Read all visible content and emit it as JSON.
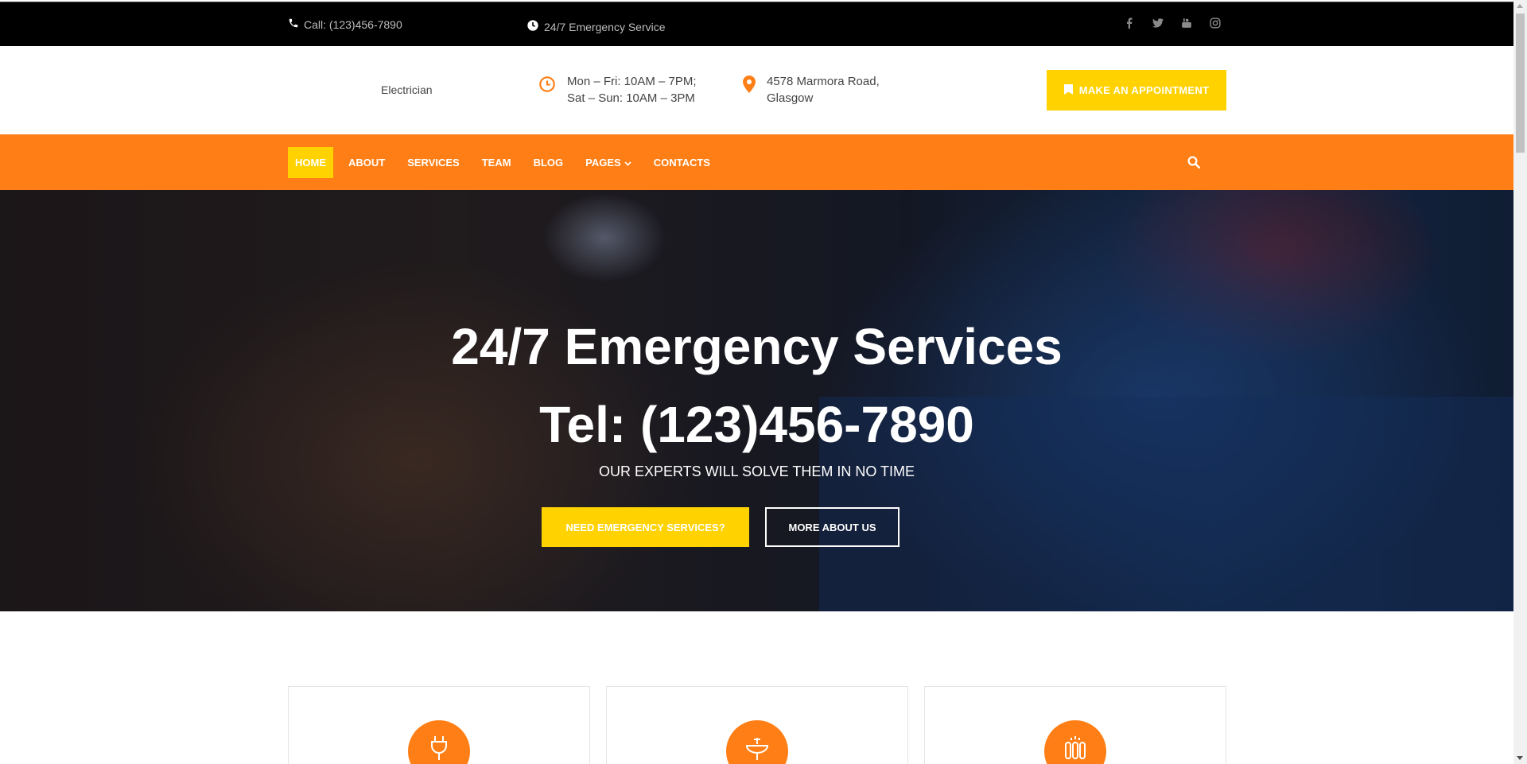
{
  "topbar": {
    "call": "Call: (123)456-7890",
    "emergency": "24/7 Emergency Service",
    "social": [
      "facebook-icon",
      "twitter-icon",
      "youtube-icon",
      "instagram-icon"
    ]
  },
  "header": {
    "brand": "Electrician",
    "hours_line1": "Mon – Fri: 10AM – 7PM;",
    "hours_line2": "Sat – Sun: 10AM – 3PM",
    "address_line1": "4578 Marmora Road,",
    "address_line2": "Glasgow",
    "appointment_label": "MAKE AN APPOINTMENT"
  },
  "nav": {
    "items": [
      {
        "label": "HOME"
      },
      {
        "label": "ABOUT"
      },
      {
        "label": "SERVICES"
      },
      {
        "label": "TEAM"
      },
      {
        "label": "BLOG"
      },
      {
        "label": "PAGES"
      },
      {
        "label": "CONTACTS"
      }
    ]
  },
  "hero": {
    "title": "24/7 Emergency Services",
    "phone": "Tel: (123)456-7890",
    "subtitle": "OUR EXPERTS WILL SOLVE THEM IN NO TIME",
    "primary_button": "NEED EMERGENCY SERVICES?",
    "secondary_button": "MORE ABOUT US"
  },
  "cards": [
    {
      "icon": "plug-icon"
    },
    {
      "icon": "sink-icon"
    },
    {
      "icon": "radiator-icon"
    }
  ],
  "colors": {
    "accent_orange": "#ff7f16",
    "accent_yellow": "#ffd200",
    "topbar_bg": "#000000"
  }
}
